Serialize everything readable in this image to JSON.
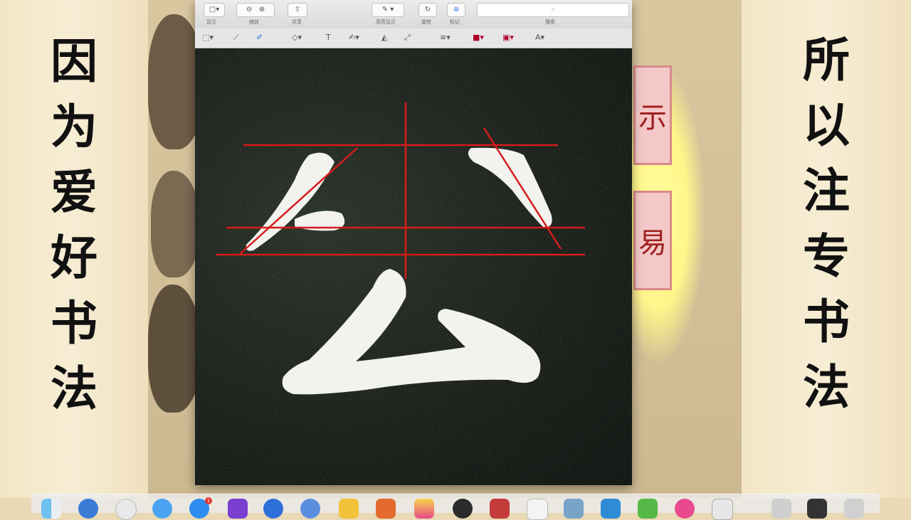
{
  "left_calligraphy": [
    "因",
    "为",
    "爱",
    "好",
    "书",
    "法"
  ],
  "right_calligraphy": [
    "所",
    "以",
    "注",
    "专",
    "书",
    "法"
  ],
  "background_seals": [
    "示",
    "易"
  ],
  "preview": {
    "toolbar": {
      "view_label": "显示",
      "zoom_label": "缩放",
      "share_label": "共享",
      "markup_toolbar_label": "高亮显示",
      "rotate_label": "旋转",
      "markup_label": "标记",
      "search_label": "搜索"
    },
    "image": {
      "character": "公",
      "guide_line_color": "#d61b1b",
      "stroke_color": "#f2f2ee"
    },
    "markup_tools": [
      "select-icon",
      "sketch-icon",
      "draw-icon",
      "shapes-icon",
      "text-icon",
      "sign-icon",
      "adjust-color-icon",
      "adjust-size-icon",
      "line-style-icon",
      "border-color-icon",
      "fill-color-icon",
      "text-style-icon"
    ]
  },
  "dock": {
    "apps": [
      "finder-icon",
      "launchpad-icon",
      "safari-icon",
      "mail-icon",
      "app-store-icon",
      "photos-icon",
      "notes-icon",
      "calendar-icon",
      "messages-icon",
      "music-icon",
      "preview-icon",
      "terminal-icon",
      "trash-icon"
    ],
    "app_store_badge": "1"
  }
}
